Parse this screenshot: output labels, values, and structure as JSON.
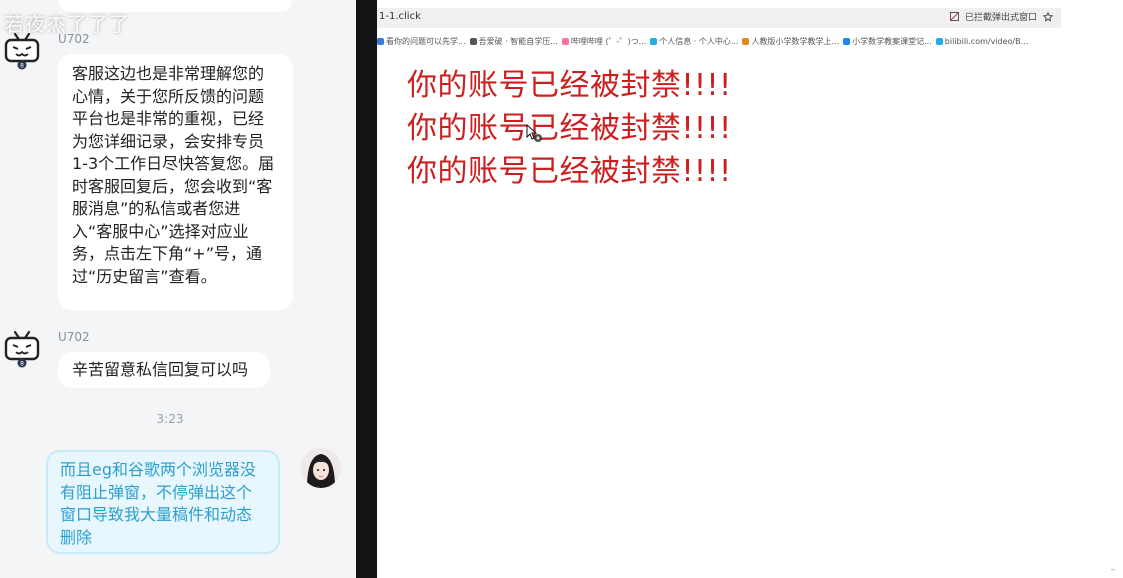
{
  "chat": {
    "watermark": "若夜杰了了了",
    "messages": [
      {
        "sender": "U702",
        "text": "客服这边也是非常理解您的心情，关于您所反馈的问题平台也是非常的重视，已经为您详细记录，会安排专员1-3个工作日尽快答复您。届时客服回复后，您会收到“客服消息”的私信或者您进入“客服中心”选择对应业务，点击左下角“+”号，通过“历史留言”查看。"
      },
      {
        "sender": "U702",
        "text": "辛苦留意私信回复可以吗"
      }
    ],
    "timestamp": "3:23",
    "my_message": "而且eg和谷歌两个浏览器没有阻止弹窗，不停弹出这个窗口导致我大量稿件和动态删除"
  },
  "browser": {
    "url": "1-1.click",
    "addr_right_label": "已拦截弹出式窗口",
    "bookmarks": [
      {
        "label": "看你的问题可以先学...",
        "color": "#3d7bd9"
      },
      {
        "label": "吾爱破 · 智能自学压...",
        "color": "#555555"
      },
      {
        "label": "哔哩哔哩 (゜-゜)つ...",
        "color": "#fb7299"
      },
      {
        "label": "个人信息 · 个人中心...",
        "color": "#23ade5"
      },
      {
        "label": "人教版小学数学教学上...",
        "color": "#e08a1e"
      },
      {
        "label": "小学数学教案课堂记...",
        "color": "#1e88e5"
      },
      {
        "label": "bilibili.com/video/B...",
        "color": "#23ade5"
      }
    ],
    "page_lines": [
      "你的账号已经被封禁!!!!",
      "你的账号已经被封禁!!!!",
      "你的账号已经被封禁!!!!"
    ],
    "corner_mark": "_"
  }
}
